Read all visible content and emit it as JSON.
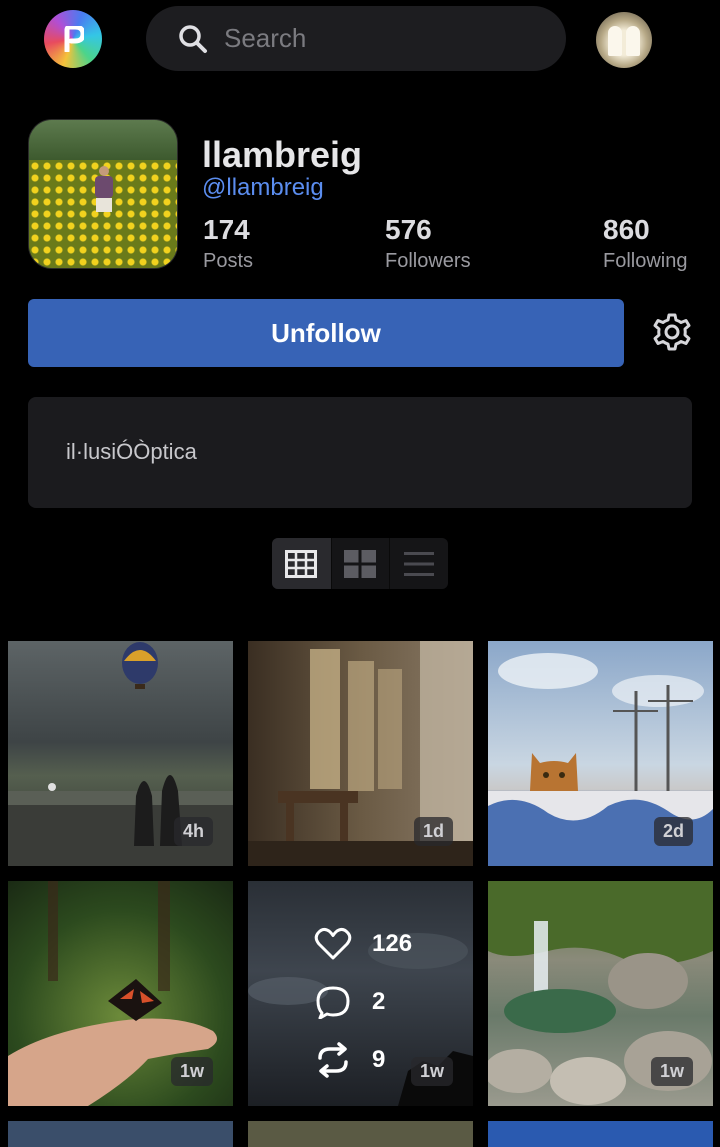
{
  "search": {
    "placeholder": "Search"
  },
  "profile": {
    "name": "llambreig",
    "handle": "@llambreig",
    "stats": [
      {
        "value": "174",
        "label": "Posts"
      },
      {
        "value": "576",
        "label": "Followers"
      },
      {
        "value": "860",
        "label": "Following"
      }
    ],
    "follow_button": "Unfollow",
    "bio": "il·lusiÓÒptica"
  },
  "posts": [
    {
      "age": "4h",
      "subject": "hot air balloon over misty hills"
    },
    {
      "age": "1d",
      "subject": "sunlit window and wooden stool"
    },
    {
      "age": "2d",
      "subject": "cat peeking over tiled wall"
    },
    {
      "age": "1w",
      "subject": "butterfly on hand in ferns"
    },
    {
      "age": "1w",
      "subject": "stormy clouds",
      "likes": "126",
      "comments": "2",
      "reposts": "9"
    },
    {
      "age": "1w",
      "subject": "waterfall and rocky pool"
    }
  ],
  "colors": {
    "accent": "#3763b6",
    "handle": "#5b8def",
    "background": "#000000"
  }
}
